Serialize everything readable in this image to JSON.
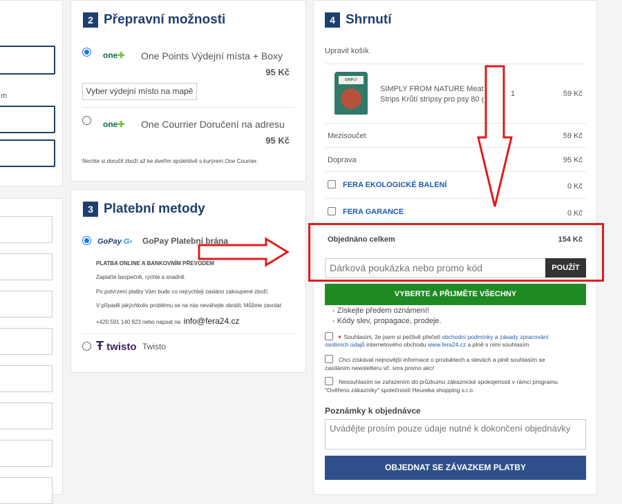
{
  "left_panel": {
    "fragment_label": "m"
  },
  "shipping": {
    "step": "2",
    "title": "Přepravní možnosti",
    "options": [
      {
        "logo": "one",
        "label": "One Points Výdejní místa + Boxy",
        "price": "95 Kč",
        "selected": true
      },
      {
        "logo": "one",
        "label": "One Courrier Doručení na adresu",
        "price": "95 Kč",
        "selected": false
      }
    ],
    "pickup_button": "Vyber výdejní místo na mapě",
    "note": "Nechte si doručit zboží až ke dveřím spolehlivě s kurýrem One Courrier."
  },
  "payment": {
    "step": "3",
    "title": "Platební metody",
    "gopay_logo": "GoPay",
    "gopay_label": "GoPay Platební brána",
    "gopay_heading": "PLATBA ONLINE A BANKOVNÍM PŘEVODEM",
    "gopay_lines": [
      "Zaplaťte bezpečně, rychle a snadně.",
      "Po potvrzení platby Vám bude co nejrychleji zasláno zakoupené zboží.",
      "V případě jakýchkoliv problému se na nás neváhejte obrátit. Můžete zavolat"
    ],
    "gopay_contact": "+420 591 140 923 nebo napsat na",
    "gopay_email": "info@fera24.cz",
    "twisto_logo": "twisto",
    "twisto_label": "Twisto"
  },
  "summary": {
    "step": "4",
    "title": "Shrnutí",
    "edit_cart": "Upravit košík",
    "product": {
      "name_line1": "SIMPLY FROM NATURE Meat",
      "name_line2": "Strips Krůtí stripsy pro psy 80 g",
      "qty": "1",
      "price": "59 Kč"
    },
    "subtotal_label": "Mezisoučet",
    "subtotal_value": "59 Kč",
    "shipping_label": "Doprava",
    "shipping_value": "95 Kč",
    "eco_label": "FERA EKOLOGICKÉ BALENÍ",
    "eco_value": "0 Kč",
    "guarantee_label": "FERA GARANCE",
    "guarantee_value": "0 Kč",
    "total_label": "Objednáno celkem",
    "total_value": "154 Kč",
    "promo_placeholder": "Dárková poukázka nebo promo kód",
    "promo_button": "POUŽÍT",
    "accept_all_button": "VYBERTE A PŘIJMĚTE VŠECHNY",
    "benefits": [
      "- Získejte předem oznámení!",
      "- Kódy slev, propagace, prodeje."
    ],
    "consent1_a": "Souhlasím, že jsem si pečlivě přečetl",
    "consent1_link1": "obchodní podmínky",
    "consent1_and": "a",
    "consent1_link2a": "zásady zpracování",
    "consent1_link2b": "osobních údajů",
    "consent1_b": "internetového obchodu",
    "consent1_link3": "www.fera24.cz",
    "consent1_c": "a plně s nimi souhlasím",
    "consent2_line1": "Chci získávat nejnovější informace o produktech a slevách a plně souhlasím se",
    "consent2_line2": "zasíláním newsletteru vč. sms promo akcí",
    "consent3_line1": "Nesouhlasím se zařazením do průzkumu zákaznické spokojenosti v rámci programu",
    "consent3_line2": "\"Ověřeno zákazníky\" společností Heureka shopping s.r.o.",
    "notes_label": "Poznámky k objednávce",
    "notes_placeholder": "Uvádějte prosím pouze údaje nutné k dokončení objednávky",
    "order_button": "OBJEDNAT SE ZÁVAZKEM PLATBY"
  },
  "colors": {
    "brand_blue": "#1d3f6e",
    "green": "#1f8a24",
    "annotation_red": "#e11b1b"
  }
}
